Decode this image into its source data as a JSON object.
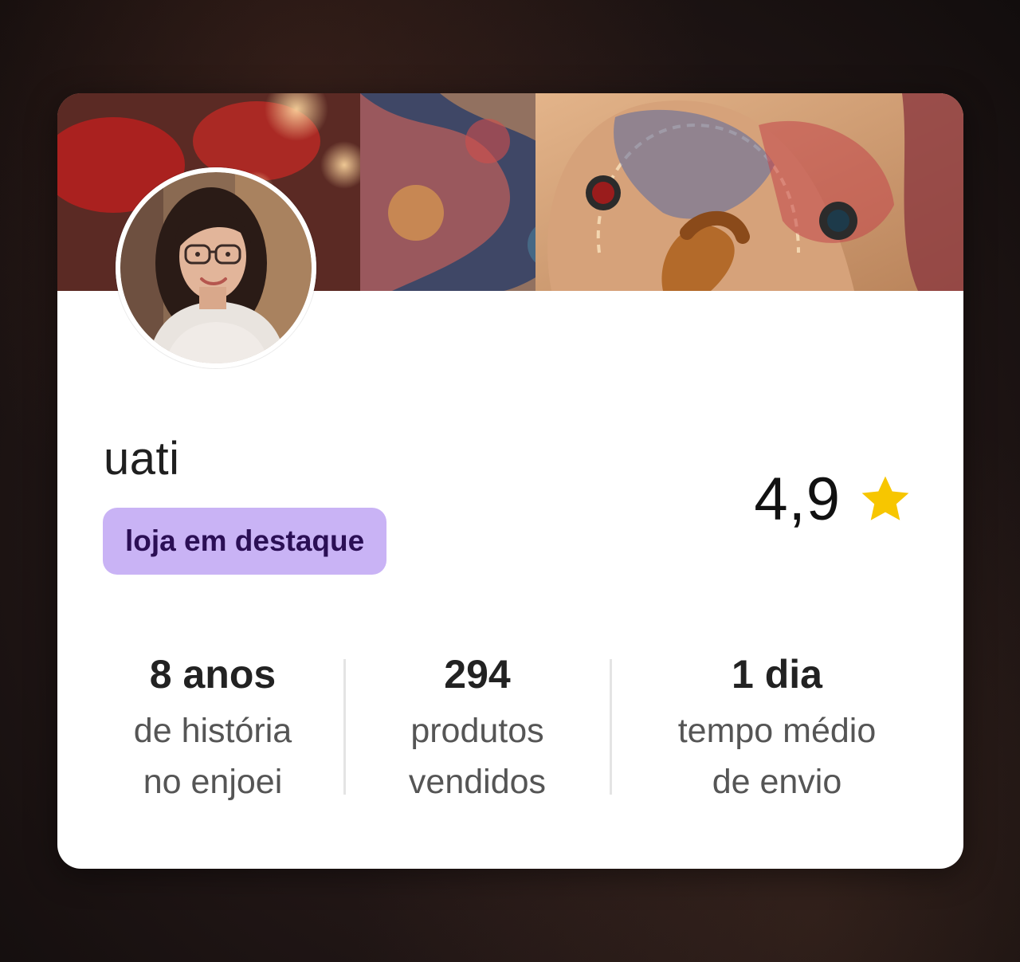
{
  "shop": {
    "name": "uati",
    "badge_label": "loja em destaque",
    "rating": "4,9"
  },
  "stats": [
    {
      "value": "8 anos",
      "label_line1": "de história",
      "label_line2": "no enjoei"
    },
    {
      "value": "294",
      "label_line1": "produtos",
      "label_line2": "vendidos"
    },
    {
      "value": "1 dia",
      "label_line1": "tempo médio",
      "label_line2": "de envio"
    }
  ],
  "icons": {
    "rating": "star-icon"
  },
  "colors": {
    "badge_bg": "#c9b3f5",
    "badge_text": "#2b0f55",
    "star": "#f7c600",
    "card_bg": "#ffffff"
  }
}
